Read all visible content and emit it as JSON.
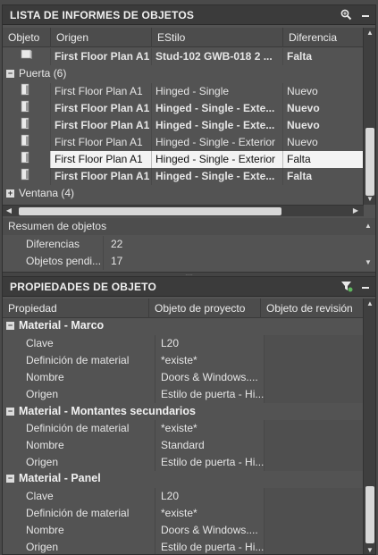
{
  "report": {
    "title": "LISTA DE INFORMES DE OBJETOS",
    "columns": [
      "Objeto",
      "Origen",
      "EStilo",
      "Diferencia"
    ],
    "rows": [
      {
        "origen": "First Floor Plan A1",
        "estilo": "Stud-102 GWB-018 2 ...",
        "diferencia": "Falta",
        "bold": true
      },
      {
        "origen": "First Floor Plan A1",
        "estilo": "Hinged - Single",
        "diferencia": "Nuevo",
        "bold": false
      },
      {
        "origen": "First Floor Plan A1",
        "estilo": "Hinged - Single - Exte...",
        "diferencia": "Nuevo",
        "bold": true
      },
      {
        "origen": "First Floor Plan A1",
        "estilo": "Hinged - Single - Exte...",
        "diferencia": "Nuevo",
        "bold": true
      },
      {
        "origen": "First Floor Plan A1",
        "estilo": "Hinged - Single - Exterior",
        "diferencia": "Nuevo",
        "bold": false
      },
      {
        "origen": "First Floor Plan A1",
        "estilo": "Hinged - Single - Exterior",
        "diferencia": "Falta",
        "bold": false,
        "selected": true
      },
      {
        "origen": "First Floor Plan A1",
        "estilo": "Hinged - Single - Exte...",
        "diferencia": "Falta",
        "bold": true
      }
    ],
    "groups": {
      "puerta": "Puerta (6)",
      "ventana": "Ventana (4)"
    },
    "expanded_symbol": "−",
    "collapsed_symbol": "+"
  },
  "summary": {
    "title": "Resumen de objetos",
    "rows": [
      {
        "key": "Diferencias",
        "value": "22"
      },
      {
        "key": "Objetos pendi...",
        "value": "17"
      }
    ]
  },
  "properties": {
    "title": "PROPIEDADES DE OBJETO",
    "columns": [
      "Propiedad",
      "Objeto de proyecto",
      "Objeto de revisión"
    ],
    "sections": [
      {
        "name": "Material - Marco",
        "rows": [
          {
            "k": "Clave",
            "v": "L20"
          },
          {
            "k": "Definición de material",
            "v": "*existe*"
          },
          {
            "k": "Nombre",
            "v": "Doors & Windows...."
          },
          {
            "k": "Origen",
            "v": "Estilo de puerta - Hi..."
          }
        ]
      },
      {
        "name": "Material - Montantes secundarios",
        "rows": [
          {
            "k": "Definición de material",
            "v": "*existe*"
          },
          {
            "k": "Nombre",
            "v": "Standard"
          },
          {
            "k": "Origen",
            "v": "Estilo de puerta - Hi..."
          }
        ]
      },
      {
        "name": "Material - Panel",
        "rows": [
          {
            "k": "Clave",
            "v": "L20"
          },
          {
            "k": "Definición de material",
            "v": "*existe*"
          },
          {
            "k": "Nombre",
            "v": "Doors & Windows...."
          },
          {
            "k": "Origen",
            "v": "Estilo de puerta - Hi..."
          }
        ]
      }
    ]
  },
  "icons": {
    "search": "search-icon",
    "minimize": "minimize-icon",
    "filter": "filter-icon",
    "door": "door-icon",
    "wall": "wall-icon"
  }
}
